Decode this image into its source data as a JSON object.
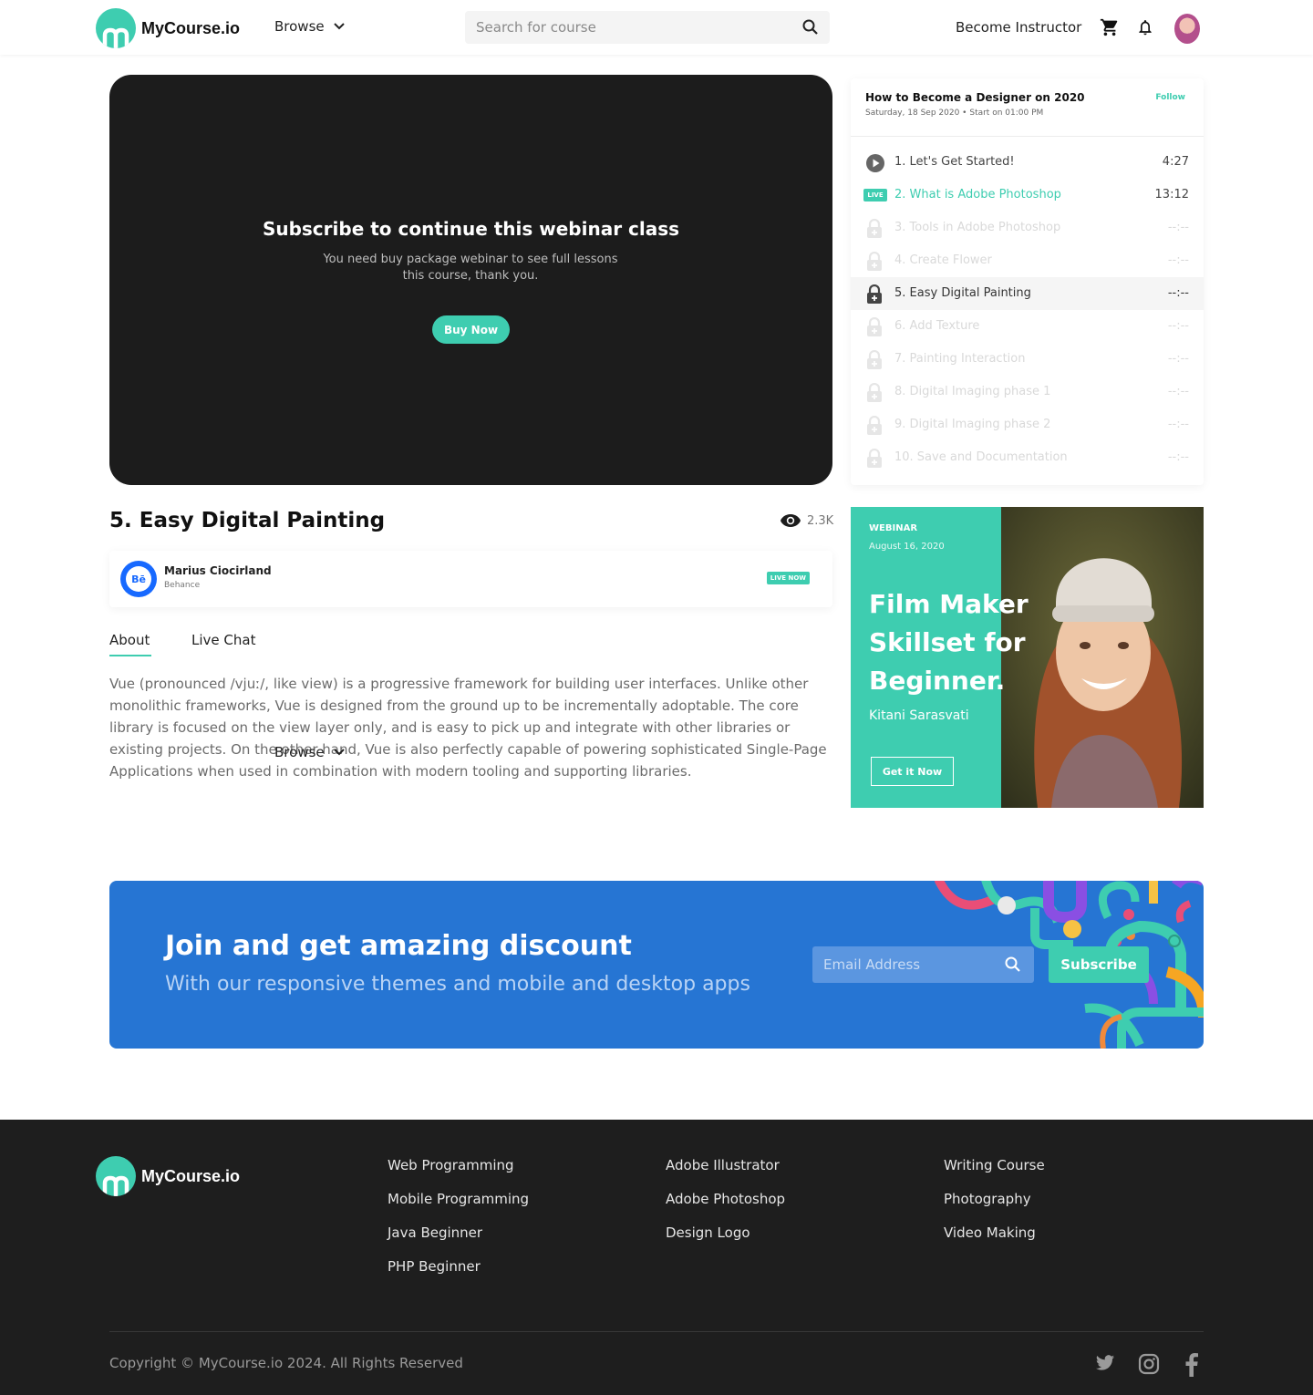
{
  "header": {
    "logo_text": "MyCourse.io",
    "browse_label": "Browse",
    "search_placeholder": "Search for course",
    "become_instructor": "Become Instructor"
  },
  "video": {
    "title": "Subscribe to continue this webinar class",
    "subtitle": "You need buy package webinar to see full lessons this course, thank you.",
    "buy_label": "Buy Now"
  },
  "playlist": {
    "title": "How to Become a Designer on 2020",
    "meta": "Saturday, 18 Sep 2020  •  Start on 01:00 PM",
    "follow_label": "Follow",
    "live_badge": "LIVE",
    "items": [
      {
        "label": "1. Let's Get Started!",
        "duration": "4:27",
        "state": "done"
      },
      {
        "label": "2. What is Adobe Photoshop",
        "duration": "13:12",
        "state": "live"
      },
      {
        "label": "3. Tools in Adobe Photoshop",
        "duration": "--:--",
        "state": "locked"
      },
      {
        "label": "4. Create Flower",
        "duration": "--:--",
        "state": "locked"
      },
      {
        "label": "5. Easy Digital Painting",
        "duration": "--:--",
        "state": "active"
      },
      {
        "label": "6. Add Texture",
        "duration": "--:--",
        "state": "locked"
      },
      {
        "label": "7. Painting Interaction",
        "duration": "--:--",
        "state": "locked"
      },
      {
        "label": "8. Digital Imaging phase 1",
        "duration": "--:--",
        "state": "locked"
      },
      {
        "label": "9. Digital Imaging phase 2",
        "duration": "--:--",
        "state": "locked"
      },
      {
        "label": "10. Save and Documentation",
        "duration": "--:--",
        "state": "locked"
      }
    ]
  },
  "lesson": {
    "title": "5. Easy Digital Painting",
    "views": "2.3K",
    "author_name": "Marius Ciocirland",
    "author_org": "Behance",
    "author_avatar_text": "Bē",
    "live_now": "LIVE NOW",
    "tabs": [
      "About",
      "Live Chat"
    ],
    "about_text": "Vue (pronounced /vjuː/, like view) is a progressive framework for building user interfaces. Unlike other monolithic frameworks, Vue is designed from the ground up to be incrementally adoptable. The core library is focused on the view layer only, and is easy to pick up and integrate with other libraries or existing projects. On the other hand, Vue is also perfectly capable of powering sophisticated Single-Page Applications when used in combination with modern tooling and supporting libraries.",
    "overlay_browse": "Browse"
  },
  "promo": {
    "tag": "WEBINAR",
    "date": "August 16, 2020",
    "title": "Film Maker Skillset for Beginner.",
    "author": "Kitani Sarasvati",
    "cta": "Get it Now"
  },
  "newsletter": {
    "title": "Join and get amazing discount",
    "subtitle": "With our responsive themes and mobile and desktop apps",
    "email_placeholder": "Email Address",
    "subscribe_label": "Subscribe"
  },
  "footer": {
    "logo_text": "MyCourse.io",
    "columns": [
      [
        "Web Programming",
        "Mobile Programming",
        "Java Beginner",
        "PHP Beginner"
      ],
      [
        "Adobe Illustrator",
        "Adobe Photoshop",
        "Design Logo"
      ],
      [
        "Writing Course",
        "Photography",
        "Video Making"
      ]
    ],
    "copyright": "Copyright © MyCourse.io 2024. All Rights Reserved"
  },
  "colors": {
    "accent": "#3ecdb0",
    "banner_blue": "#2675d3",
    "footer_bg": "#1e1e1e",
    "video_bg": "#1c1c1c"
  },
  "icons": [
    "logo-mark",
    "chevron-down-icon",
    "search-icon",
    "cart-icon",
    "bell-icon",
    "play-icon",
    "lock-icon",
    "eye-icon",
    "twitter-icon",
    "instagram-icon",
    "facebook-icon"
  ]
}
